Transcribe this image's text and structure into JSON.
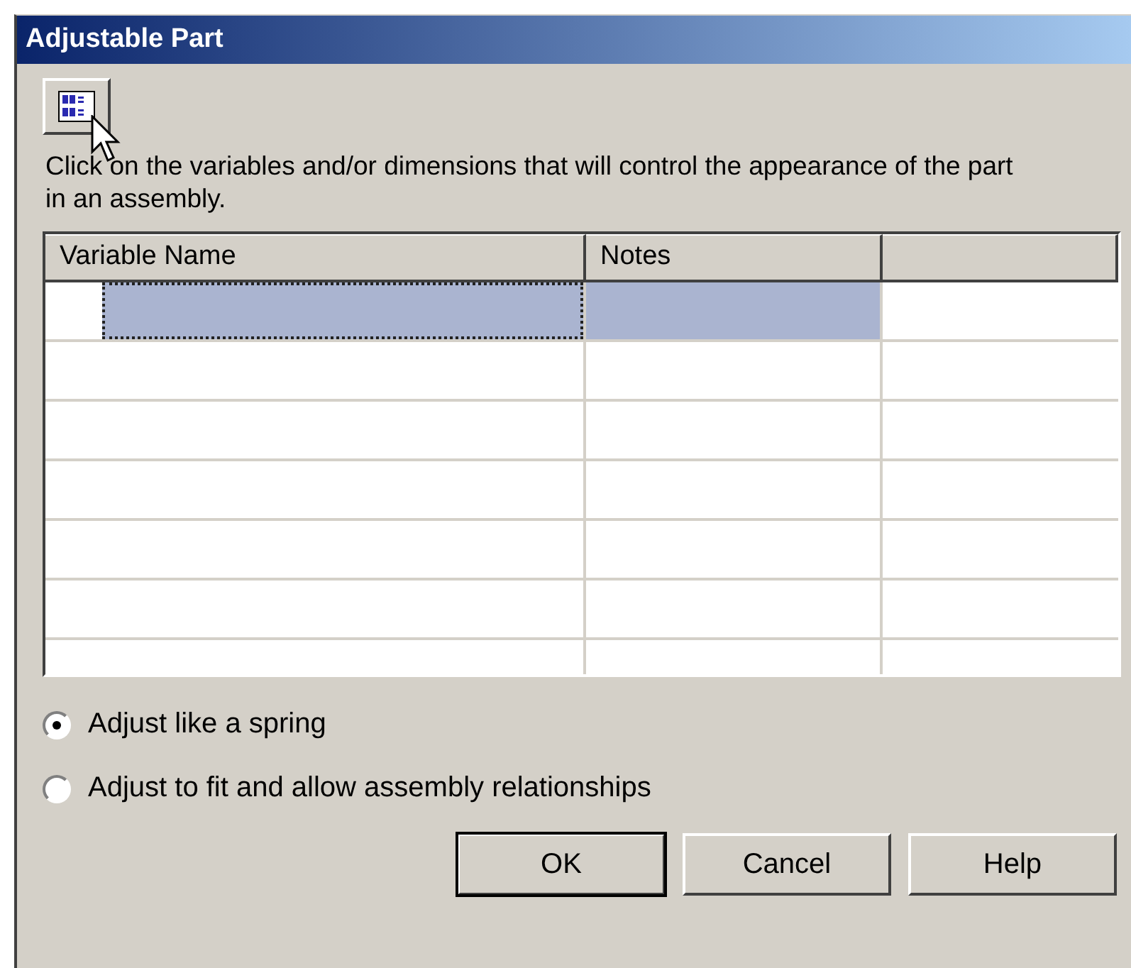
{
  "window": {
    "title": "Adjustable Part"
  },
  "instruction": "Click on the variables and/or dimensions that will control the appearance of the part in an assembly.",
  "table": {
    "columns": [
      {
        "label": "Variable Name"
      },
      {
        "label": "Notes"
      }
    ],
    "rows": [
      {
        "selected": true
      },
      {
        "selected": false
      },
      {
        "selected": false
      },
      {
        "selected": false
      },
      {
        "selected": false
      },
      {
        "selected": false
      },
      {
        "selected": false
      }
    ]
  },
  "options": [
    {
      "label": "Adjust like a spring",
      "selected": true
    },
    {
      "label": "Adjust to fit and allow assembly relationships",
      "selected": false
    }
  ],
  "buttons": [
    {
      "label": "OK",
      "default": true
    },
    {
      "label": "Cancel",
      "default": false
    },
    {
      "label": "Help",
      "default": false
    }
  ]
}
